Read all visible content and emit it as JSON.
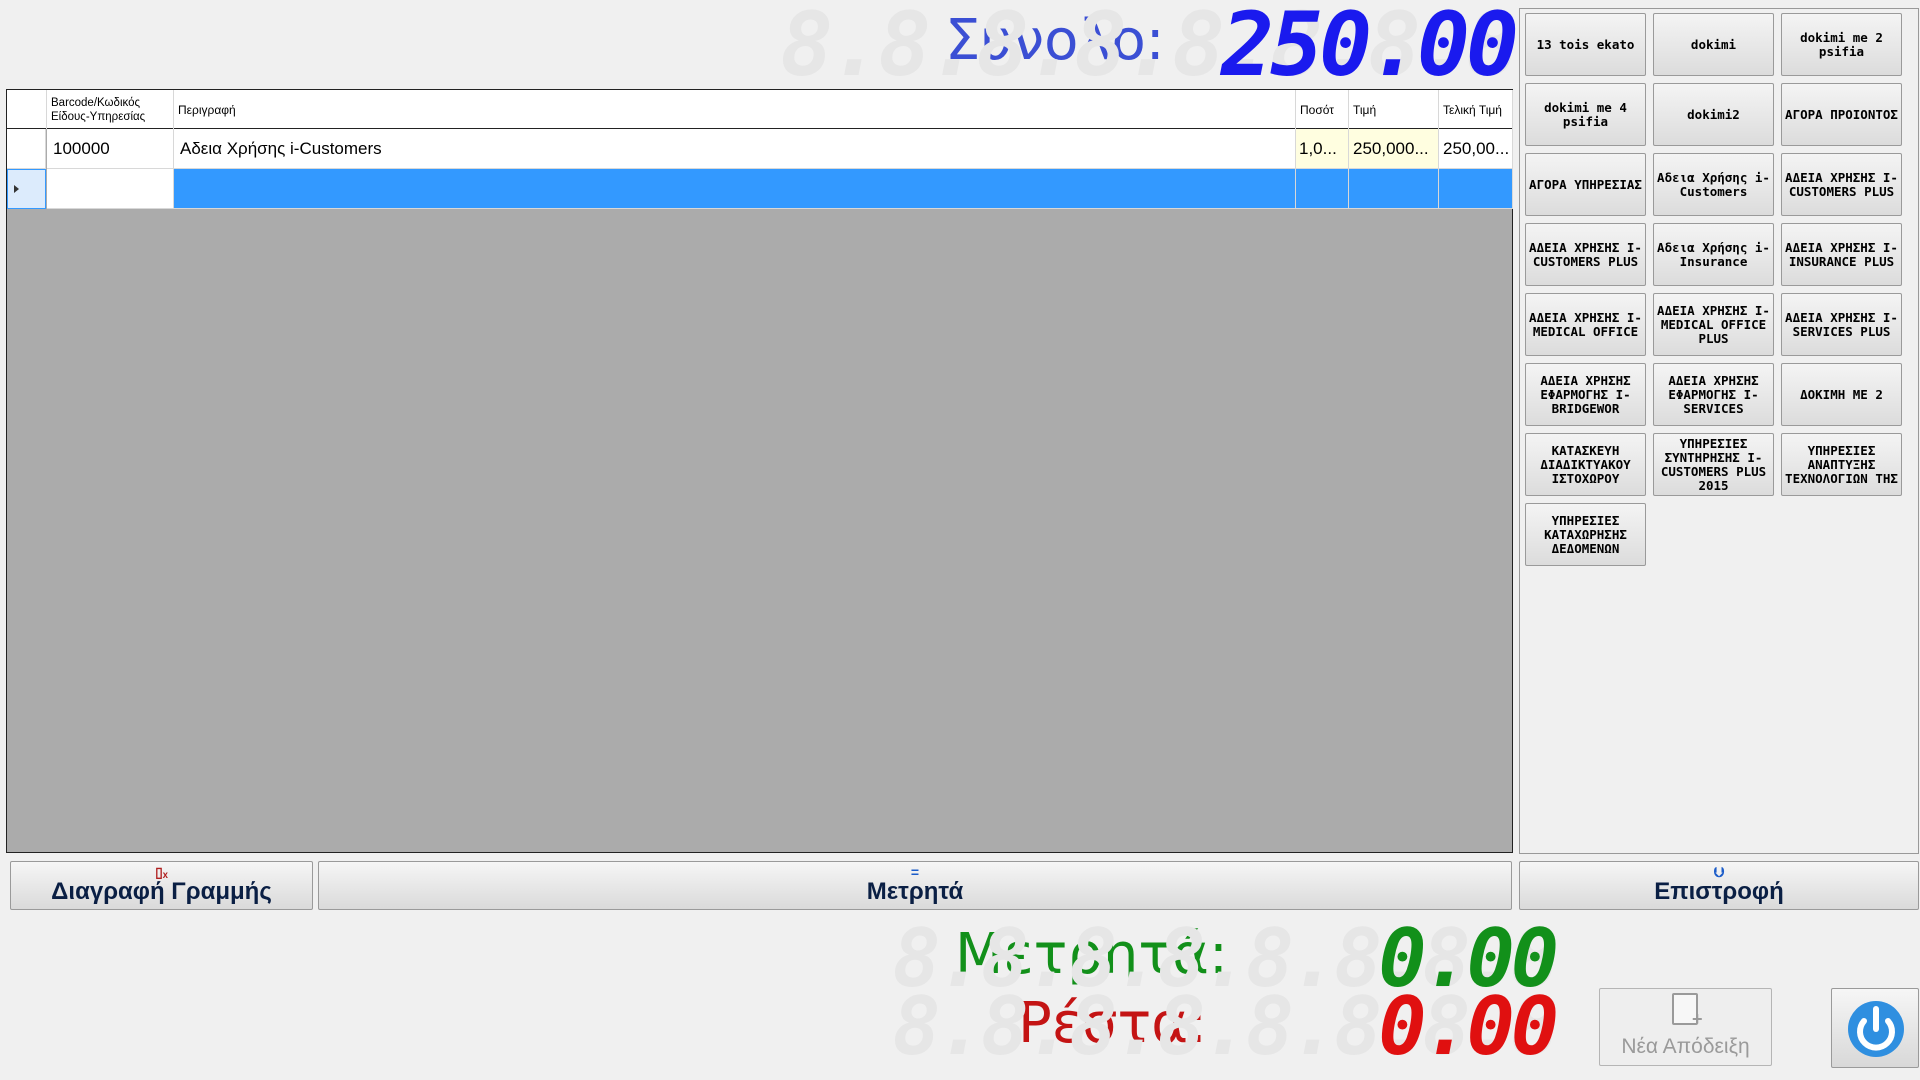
{
  "total": {
    "label": "Σύνολο:",
    "value": "250.00",
    "ghost": "8.8.8.8.8.8.8.8",
    "color": "#1a1aee"
  },
  "grid": {
    "columns": [
      {
        "key": "code",
        "label": "Barcode/Κωδικός Είδους-Υπηρεσίας"
      },
      {
        "key": "description",
        "label": "Περιγραφή"
      },
      {
        "key": "quantity",
        "label": "Ποσότ"
      },
      {
        "key": "price",
        "label": "Τιμή"
      },
      {
        "key": "final_price",
        "label": "Τελική Τιμή"
      }
    ],
    "rows": [
      {
        "code": "100000",
        "description": "Αδεια Χρήσης i-Customers",
        "quantity": "1,0...",
        "price": "250,000...",
        "final_price": "250,00..."
      },
      {
        "code": "",
        "description": "",
        "quantity": "",
        "price": "",
        "final_price": ""
      }
    ],
    "selected_row_color": "#3399ff"
  },
  "products": [
    "13 tois ekato",
    "dokimi",
    "dokimi me 2 psifia",
    "dokimi me 4 psifia",
    "dokimi2",
    "ΑΓΟΡΑ ΠΡΟΙΟΝΤΟΣ",
    "ΑΓΟΡΑ ΥΠΗΡΕΣΙΑΣ",
    "Αδεια Χρήσης i-Customers",
    "ΑΔΕΙΑ ΧΡΗΣΗΣ I-CUSTOMERS PLUS",
    "ΑΔΕΙΑ ΧΡΗΣΗΣ I-CUSTOMERS PLUS",
    "Αδεια Χρήσης i-Insurance",
    "ΑΔΕΙΑ ΧΡΗΣΗΣ I-INSURANCE PLUS",
    "ΑΔΕΙΑ ΧΡΗΣΗΣ I-MEDICAL OFFICE",
    "ΑΔΕΙΑ ΧΡΗΣΗΣ I-MEDICAL OFFICE PLUS",
    "ΑΔΕΙΑ ΧΡΗΣΗΣ I-SERVICES PLUS",
    "ΑΔΕΙΑ ΧΡΗΣΗΣ ΕΦΑΡΜΟΓΗΣ I-BRIDGEWOR",
    "ΑΔΕΙΑ ΧΡΗΣΗΣ ΕΦΑΡΜΟΓΗΣ I-SERVICES",
    "ΔΟΚΙΜΗ ΜΕ 2",
    "ΚΑΤΑΣΚΕΥΗ ΔΙΑΔΙΚΤΥΑΚΟΥ ΙΣΤΟΧΩΡΟΥ",
    "ΥΠΗΡΕΣΙΕΣ ΣΥΝΤΗΡΗΣΗΣ I-CUSTOMERS PLUS 2015",
    "ΥΠΗΡΕΣΙΕΣ ΑΝΑΠΤΥΞΗΣ ΤΕΧΝΟΛΟΓΙΩΝ ΤΗΣ",
    "ΥΠΗΡΕΣΙΕΣ ΚΑΤΑΧΩΡΗΣΗΣ ΔΕΔΟΜΕΝΩΝ"
  ],
  "actions": {
    "delete_line": {
      "label": "Διαγραφή Γραμμής",
      "icon": "delete-line-icon"
    },
    "cash": {
      "label": "Μετρητά",
      "icon": "equals-icon"
    },
    "return": {
      "label": "Επιστροφή",
      "icon": "return-arrow-icon"
    }
  },
  "cash": {
    "label": "Μετρητά:",
    "value": "0.00",
    "ghost": "8.8.8.8.8.8.8.8",
    "color": "#12901a"
  },
  "change": {
    "label": "Ρέστα:",
    "value": "0.00",
    "ghost": "8.8.8.8.8.8.8.8",
    "color": "#e01010"
  },
  "new_receipt": {
    "label": "Νέα Απόδειξη",
    "icon": "new-receipt-icon",
    "enabled": false
  },
  "power": {
    "icon": "power-icon",
    "color": "#2f8fe0"
  }
}
